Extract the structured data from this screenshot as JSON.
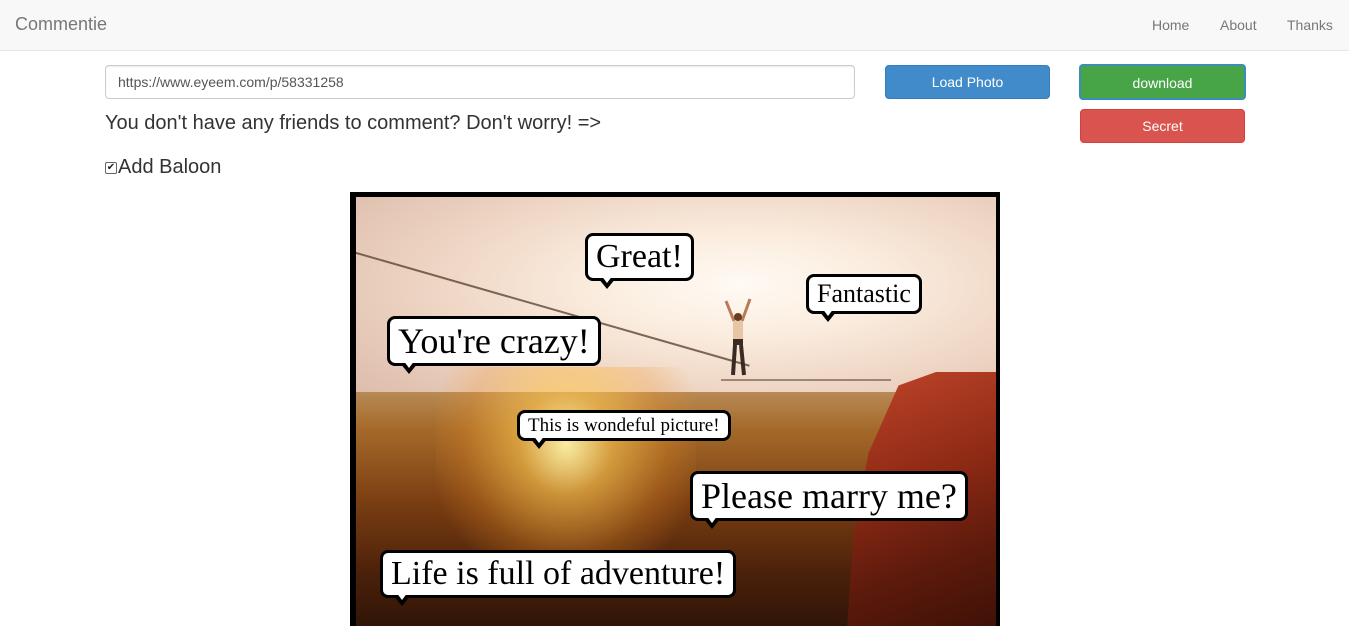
{
  "navbar": {
    "brand": "Commentie",
    "links": [
      "Home",
      "About",
      "Thanks"
    ]
  },
  "form": {
    "url_value": "https://www.eyeem.com/p/58331258",
    "load_label": "Load Photo",
    "download_label": "download",
    "secret_label": "Secret",
    "prompt": "You don't have any friends to comment? Don't worry! =>",
    "add_balloon_label": "Add Baloon",
    "add_balloon_checked": true
  },
  "balloons": [
    "Great!",
    "Fantastic",
    "You're crazy!",
    "This is wondeful picture!",
    "Please marry me?",
    "Life is full of adventure!"
  ],
  "colors": {
    "load": "#428bca",
    "download": "#47a447",
    "secret": "#d9534f"
  }
}
